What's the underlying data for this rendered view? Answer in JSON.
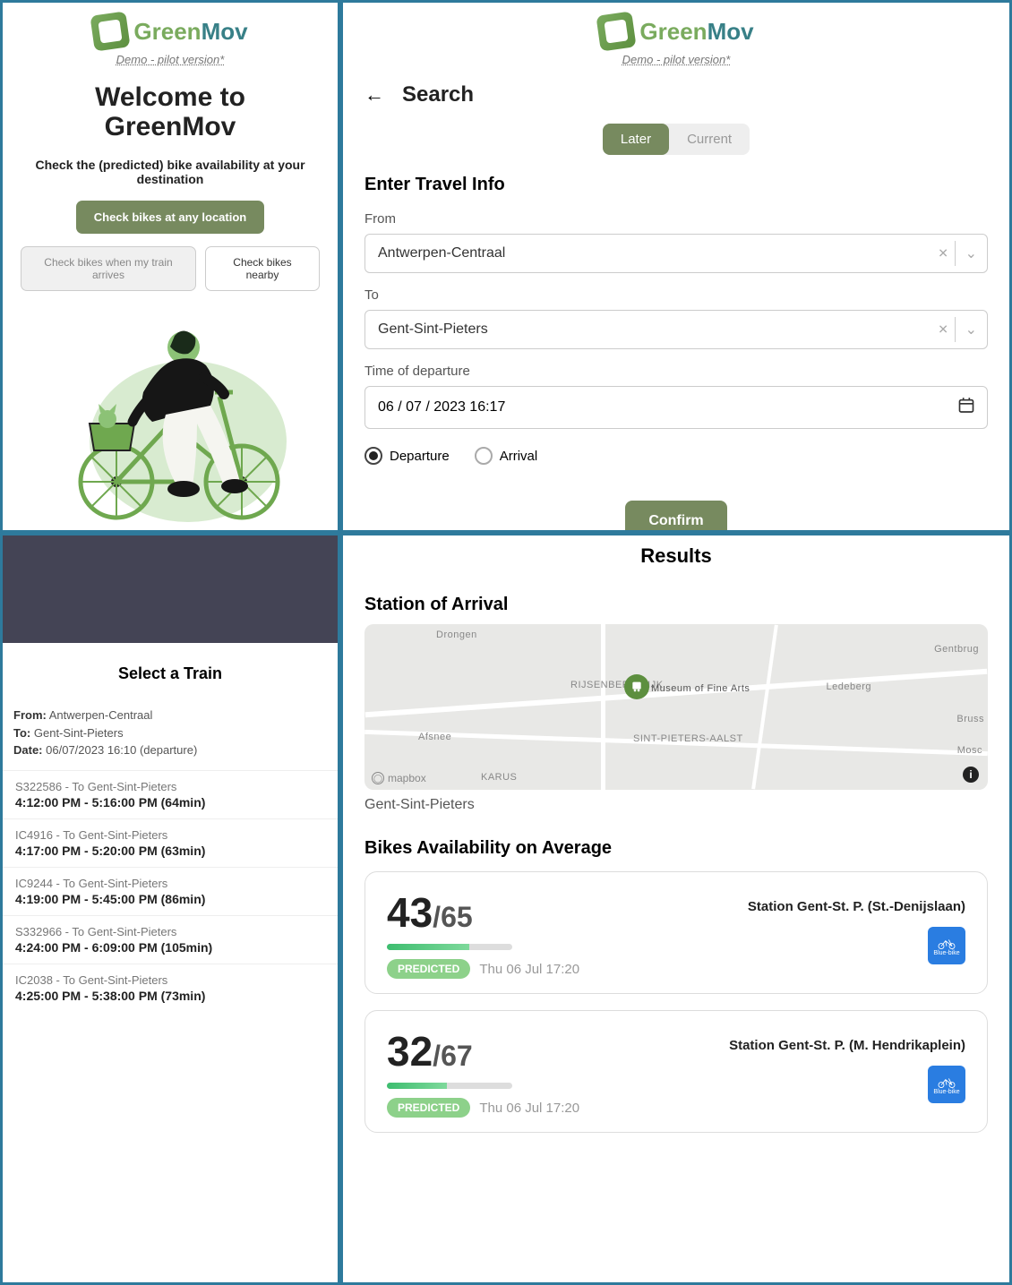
{
  "logo": {
    "green": "Green",
    "mov": "Mov"
  },
  "demo_text": "Demo - pilot version*",
  "welcome": {
    "title_line1": "Welcome to",
    "title_line2": "GreenMov",
    "subtitle": "Check the (predicted) bike availability at your destination",
    "btn_any": "Check bikes at any location",
    "btn_train": "Check bikes when my train arrives",
    "btn_nearby": "Check bikes nearby"
  },
  "search": {
    "title": "Search",
    "toggle": {
      "later": "Later",
      "current": "Current"
    },
    "form_heading": "Enter Travel Info",
    "from_label": "From",
    "from_value": "Antwerpen-Centraal",
    "to_label": "To",
    "to_value": "Gent-Sint-Pieters",
    "time_label": "Time of departure",
    "time_value": "06 / 07 / 2023 16:17",
    "radio_departure": "Departure",
    "radio_arrival": "Arrival",
    "confirm": "Confirm"
  },
  "select_train": {
    "heading": "Select a Train",
    "from_label": "From:",
    "from_value": "Antwerpen-Centraal",
    "to_label": "To:",
    "to_value": "Gent-Sint-Pieters",
    "date_label": "Date:",
    "date_value": "06/07/2023 16:10 (departure)",
    "items": [
      {
        "code": "S322586 - To Gent-Sint-Pieters",
        "time": "4:12:00 PM - 5:16:00 PM (64min)"
      },
      {
        "code": "IC4916 - To Gent-Sint-Pieters",
        "time": "4:17:00 PM - 5:20:00 PM (63min)"
      },
      {
        "code": "IC9244 - To Gent-Sint-Pieters",
        "time": "4:19:00 PM - 5:45:00 PM (86min)"
      },
      {
        "code": "S332966 - To Gent-Sint-Pieters",
        "time": "4:24:00 PM - 6:09:00 PM (105min)"
      },
      {
        "code": "IC2038 - To Gent-Sint-Pieters",
        "time": "4:25:00 PM - 5:38:00 PM (73min)"
      }
    ]
  },
  "results": {
    "heading": "Results",
    "station_heading": "Station of Arrival",
    "station_name": "Gent-Sint-Pieters",
    "avail_heading": "Bikes Availability on Average",
    "map": {
      "attribution": "mapbox",
      "labels": [
        "Drongen",
        "RIJSENBERGWIJK",
        "Museum of Fine Arts",
        "Ledeberg",
        "Gentbrug",
        "Afsnee",
        "SINT-PIETERS-AALST",
        "Mosc",
        "Bruss",
        "KARUS"
      ]
    },
    "cards": [
      {
        "avail": "43",
        "total": "65",
        "pct": 66,
        "tag": "PREDICTED",
        "time": "Thu 06 Jul 17:20",
        "station": "Station Gent-St. P. (St.-Denijslaan)",
        "provider": "Blue-bike"
      },
      {
        "avail": "32",
        "total": "67",
        "pct": 48,
        "tag": "PREDICTED",
        "time": "Thu 06 Jul 17:20",
        "station": "Station Gent-St. P. (M. Hendrikaplein)",
        "provider": "Blue-bike"
      }
    ]
  }
}
